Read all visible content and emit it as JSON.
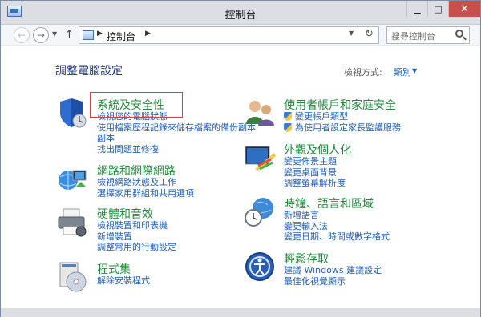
{
  "window": {
    "title": "控制台"
  },
  "address": {
    "path": "控制台"
  },
  "search": {
    "placeholder": "搜尋控制台"
  },
  "page": {
    "title": "調整電腦設定"
  },
  "view": {
    "label": "檢視方式:",
    "value": "類別"
  },
  "categories": [
    {
      "title": "系統及安全性",
      "icon": "shield-icon",
      "links": [
        "檢視您的電腦狀態",
        "使用檔案歷程記錄來儲存檔案的備份副本",
        "副本",
        "找出問題並修復"
      ]
    },
    {
      "title": "網路和網際網路",
      "icon": "network-icon",
      "links": [
        "檢視網路狀態及工作",
        "選擇家用群組和共用選項"
      ]
    },
    {
      "title": "硬體和音效",
      "icon": "printer-icon",
      "links": [
        "檢視裝置和印表機",
        "新增裝置",
        "調整常用的行動設定"
      ]
    },
    {
      "title": "程式集",
      "icon": "programs-icon",
      "links": [
        "解除安裝程式"
      ]
    },
    {
      "title": "使用者帳戶和家庭安全",
      "icon": "users-icon",
      "links": [
        "變更帳戶類型",
        "為使用者設定家長監護服務"
      ]
    },
    {
      "title": "外觀及個人化",
      "icon": "appearance-icon",
      "links": [
        "變更佈景主題",
        "變更桌面背景",
        "調整螢幕解析度"
      ]
    },
    {
      "title": "時鐘、語言和區域",
      "icon": "clock-globe-icon",
      "links": [
        "新增語言",
        "變更輸入法",
        "變更日期、時間或數字格式"
      ]
    },
    {
      "title": "輕鬆存取",
      "icon": "ease-of-access-icon",
      "links": [
        "建議 Windows 建議設定",
        "最佳化視覺顯示"
      ]
    }
  ],
  "colors": {
    "title": "#1e3287",
    "category": "#1e8b3b",
    "link": "#1f5fb5",
    "highlight": "#e33b3b"
  }
}
